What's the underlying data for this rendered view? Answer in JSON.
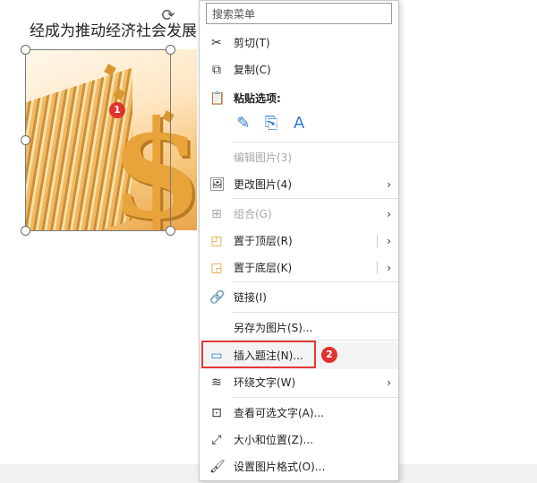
{
  "document": {
    "text": "经成为推动经济社会发展"
  },
  "picture": {
    "symbol": "$"
  },
  "badges": {
    "one": "1",
    "two": "2"
  },
  "context_menu": {
    "search_placeholder": "搜索菜单",
    "items": {
      "cut": "剪切(T)",
      "copy": "复制(C)",
      "paste_options": "粘贴选项:",
      "edit_picture": "编辑图片(3)",
      "change_picture": "更改图片(4)",
      "group": "组合(G)",
      "bring_to_front": "置于顶层(R)",
      "send_to_back": "置于底层(K)",
      "link": "链接(I)",
      "save_as_picture": "另存为图片(S)...",
      "insert_caption": "插入题注(N)...",
      "wrap_text": "环绕文字(W)",
      "view_alt_text": "查看可选文字(A)...",
      "size_position": "大小和位置(Z)...",
      "format_picture": "设置图片格式(O)..."
    }
  },
  "colors": {
    "highlight": "#e53935",
    "badge": "#e0332e",
    "accent": "#2b7bd0"
  }
}
